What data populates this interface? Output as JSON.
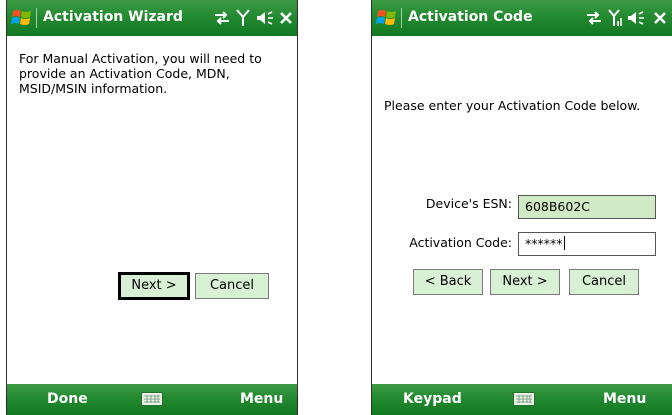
{
  "wizard": {
    "title": "Activation Wizard",
    "body_text": "For Manual Activation, you will need to provide an Activation Code, MDN, MSID/MSIN information.",
    "next_button": "Next >",
    "cancel_button": "Cancel",
    "softkey_left": "Done",
    "softkey_right": "Menu"
  },
  "code": {
    "title": "Activation Code",
    "instruction": "Please enter your Activation Code below.",
    "esn_label": "Device's ESN:",
    "esn_value": "608B602C",
    "code_label": "Activation Code:",
    "code_value": "******",
    "back_button": "< Back",
    "next_button": "Next >",
    "cancel_button": "Cancel",
    "softkey_left": "Keypad",
    "softkey_right": "Menu"
  },
  "icons": [
    "windows-logo-icon",
    "connectivity-icon",
    "signal-strength-icon",
    "speaker-volume-icon",
    "close-icon",
    "keyboard-icon"
  ],
  "colors": {
    "titlebar": "#238a32",
    "button_face": "#d8f0d3",
    "readonly_field": "#cfeac4"
  }
}
